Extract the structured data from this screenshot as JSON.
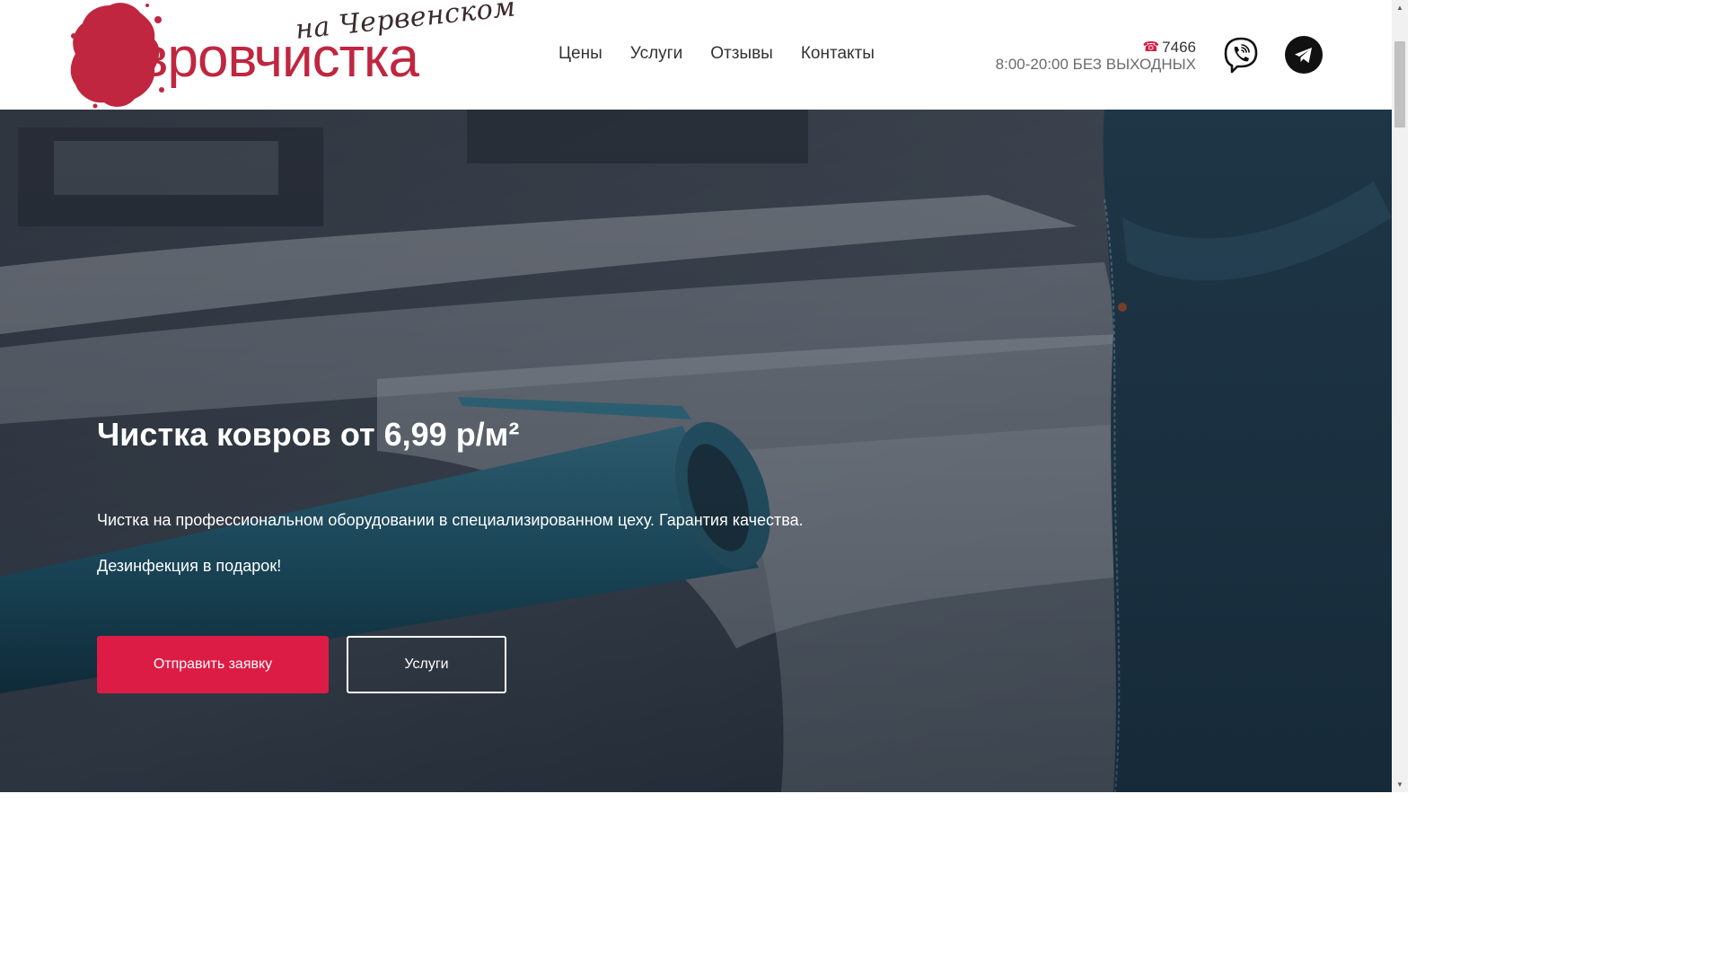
{
  "header": {
    "logo": {
      "script_text": "на Червенском",
      "main_text": "Ковровчистка",
      "accent_color": "#c0263f"
    },
    "nav": [
      {
        "label": "Цены"
      },
      {
        "label": "Услуги"
      },
      {
        "label": "Отзывы"
      },
      {
        "label": "Контакты"
      }
    ],
    "contact": {
      "phone_icon": "phone-icon",
      "phone": "7466",
      "hours": "8:00-20:00 БЕЗ ВЫХОДНЫХ"
    },
    "social": [
      {
        "name": "viber-icon"
      },
      {
        "name": "telegram-icon"
      }
    ]
  },
  "hero": {
    "title": "Чистка ковров от 6,99 р/м²",
    "text_1": "Чистка на профессиональном оборудовании в специализированном цеху. Гарантия качества.",
    "text_2": "Дезинфекция в подарок!",
    "primary_button": "Отправить заявку",
    "secondary_button": "Услуги",
    "primary_color": "#dd1c46"
  },
  "scrollbar": {
    "up_arrow": "▲",
    "down_arrow": "▼"
  }
}
